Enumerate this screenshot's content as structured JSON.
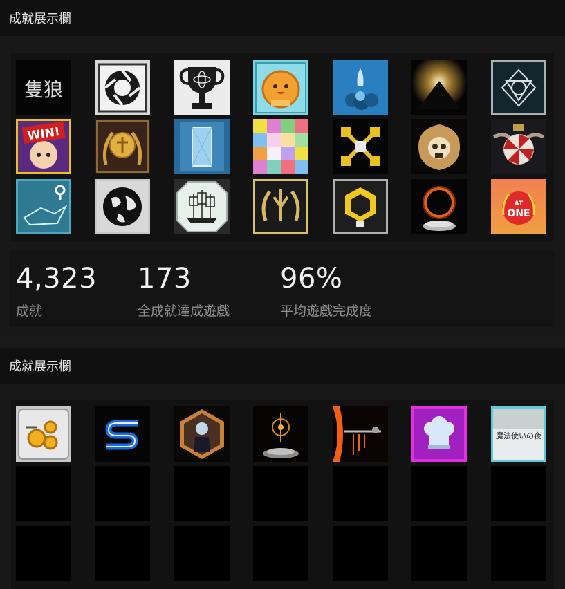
{
  "showcase1": {
    "title": "成就展示欄",
    "achievements": [
      {
        "icon": "sekiro-kanji-icon",
        "text": "隻狼"
      },
      {
        "icon": "portal-aperture-icon"
      },
      {
        "icon": "atom-trophy-icon"
      },
      {
        "icon": "slime-coin-icon"
      },
      {
        "icon": "rocket-launch-icon"
      },
      {
        "icon": "light-mountain-icon"
      },
      {
        "icon": "triangle-circle-emblem-icon"
      },
      {
        "icon": "win-anime-girl-icon",
        "text": "WIN!"
      },
      {
        "icon": "gold-medal-laurel-icon"
      },
      {
        "icon": "blue-door-icon"
      },
      {
        "icon": "color-puzzle-grid-icon"
      },
      {
        "icon": "quadcopter-drone-icon"
      },
      {
        "icon": "golden-skull-crest-icon"
      },
      {
        "icon": "umbrella-corp-crest-icon"
      },
      {
        "icon": "map-pin-icon"
      },
      {
        "icon": "globe-icon"
      },
      {
        "icon": "sailing-ship-icon"
      },
      {
        "icon": "golden-laurel-trident-icon"
      },
      {
        "icon": "hexagon-badge-icon"
      },
      {
        "icon": "dark-sign-ring-icon"
      },
      {
        "icon": "at-one-laurel-icon",
        "text_top": "AT",
        "text_bottom": "ONE"
      }
    ],
    "stats": [
      {
        "value": "4,323",
        "label": "成就"
      },
      {
        "value": "173",
        "label": "全成就達成遊戲"
      },
      {
        "value": "96%",
        "label": "平均遊戲完成度"
      }
    ]
  },
  "showcase2": {
    "title": "成就展示欄",
    "achievements": [
      {
        "icon": "gears-panel-icon"
      },
      {
        "icon": "blue-s-logo-icon"
      },
      {
        "icon": "anime-character-hexagon-icon"
      },
      {
        "icon": "elden-ring-altar-icon"
      },
      {
        "icon": "fire-weapon-icon"
      },
      {
        "icon": "chef-hat-icon"
      },
      {
        "icon": "witch-night-title-icon",
        "text": "魔法使いの夜"
      }
    ],
    "empty_slots": 14
  },
  "colors": {
    "page_bg": "#1a1a1a",
    "header_bg": "#101010",
    "stat_value": "#f2f2f2",
    "stat_label": "#8f8f8f"
  }
}
